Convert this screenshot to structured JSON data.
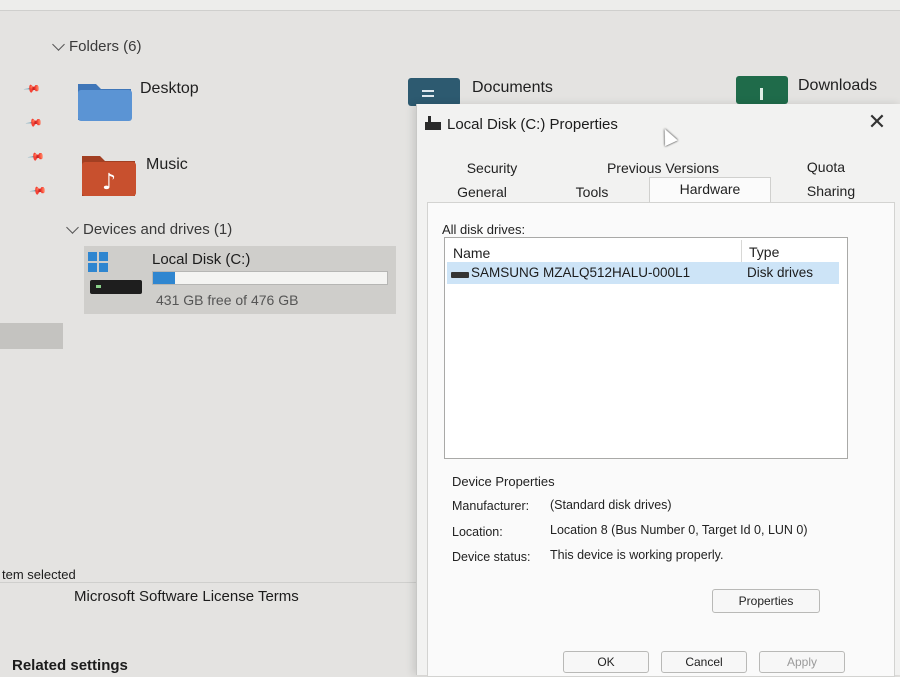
{
  "explorer": {
    "folders_header": "Folders (6)",
    "folders": [
      {
        "label": "Desktop",
        "icon": "folder-icon"
      },
      {
        "label": "Documents",
        "icon": "folder-documents-icon"
      },
      {
        "label": "Downloads",
        "icon": "folder-downloads-icon"
      },
      {
        "label": "Music",
        "icon": "folder-music-icon"
      }
    ],
    "devices_header": "Devices and drives (1)",
    "drive": {
      "name": "Local Disk (C:)",
      "free_text": "431 GB free of 476 GB",
      "used_fraction": 0.095,
      "icon": "windows-drive-icon"
    },
    "status_text": "tem selected",
    "license_link": "Microsoft Software License Terms",
    "related_settings": "Related settings"
  },
  "dialog": {
    "title": "Local Disk (C:) Properties",
    "close_label": "✕",
    "tabs_row1": [
      "Security",
      "Previous Versions",
      "Quota"
    ],
    "tabs_row2": [
      "General",
      "Tools",
      "Hardware",
      "Sharing"
    ],
    "active_tab": "Hardware",
    "all_disk_drives_label": "All disk drives:",
    "columns": [
      "Name",
      "Type"
    ],
    "rows": [
      {
        "name": "SAMSUNG MZALQ512HALU-000L1",
        "type": "Disk drives"
      }
    ],
    "device_properties": {
      "header": "Device Properties",
      "manufacturer_label": "Manufacturer:",
      "manufacturer_value": "(Standard disk drives)",
      "location_label": "Location:",
      "location_value": "Location 8 (Bus Number 0, Target Id 0, LUN 0)",
      "status_label": "Device status:",
      "status_value": "This device is working properly."
    },
    "properties_button": "Properties",
    "ok_button": "OK",
    "cancel_button": "Cancel",
    "apply_button": "Apply"
  },
  "colors": {
    "drive_fill": "#2f86d0",
    "selection": "#cde4f7",
    "folder_blue": "#4f86c6",
    "folder_dark": "#2d5a70",
    "folder_green": "#1f6b4a",
    "music_red": "#c8502e"
  }
}
